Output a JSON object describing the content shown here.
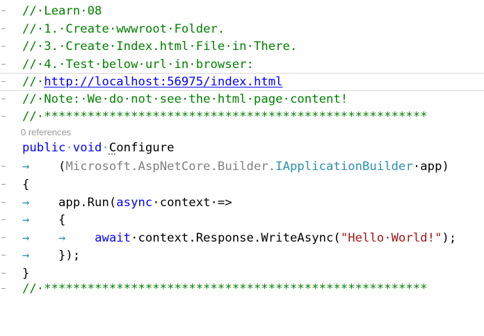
{
  "editor": {
    "lines": [
      {
        "comment": "//·Learn·08"
      },
      {
        "comment": "//·1.·Create·wwwroot·Folder."
      },
      {
        "comment": "//·3.·Create·Index.html·File·in·There."
      },
      {
        "comment": "//·4.·Test·below·url·in·browser:"
      },
      {
        "comment_prefix": "//·",
        "link": "http://localhost:56975/index.html"
      },
      {
        "comment": "//·Note:·We·do·not·see·the·html·page·content!"
      },
      {
        "comment": "//·*****************************************************"
      }
    ],
    "codelens": "0 references",
    "signature": {
      "kw1": "public",
      "kw2": "void",
      "name_first": "C",
      "name_rest": "onfigure"
    },
    "param_line": {
      "open": "(",
      "ns": "Microsoft.AspNetCore.Builder.",
      "type": "IApplicationBuilder",
      "rest": "·app)"
    },
    "brace_open": "{",
    "run_line": {
      "a": "app.Run(",
      "kw": "async",
      "b": "·context·=>"
    },
    "inner_open": "{",
    "await_line": {
      "kw": "await",
      "a": "·context.Response.WriteAsync(",
      "str": "\"Hello·World!\"",
      "b": ");"
    },
    "inner_close": "});",
    "brace_close": "}",
    "last_comment": "//·*****************************************************"
  },
  "whitespace_glyphs": {
    "tab": "→",
    "space": "·"
  },
  "colors": {
    "comment": "#008000",
    "keyword": "#0000ff",
    "type": "#2b91af",
    "string": "#a31515"
  }
}
